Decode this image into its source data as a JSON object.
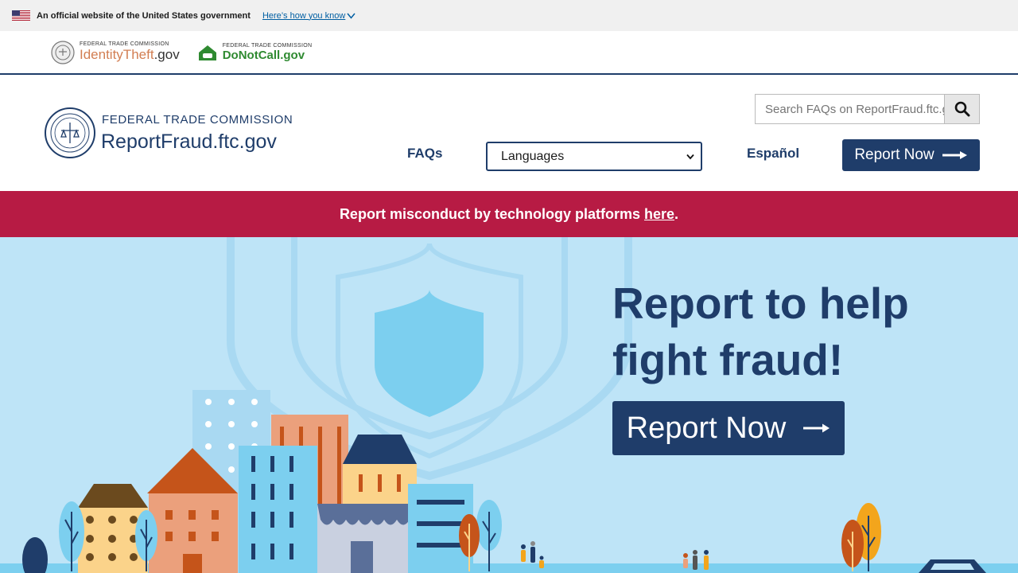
{
  "gov_banner": {
    "text": "An official website of the United States government",
    "link": "Here’s how you know"
  },
  "partners": {
    "identity_theft": {
      "small": "FEDERAL TRADE COMMISSION",
      "name_colored": "IdentityTheft",
      "name_suffix": ".gov"
    },
    "do_not_call": {
      "small": "FEDERAL TRADE COMMISSION",
      "name": "DoNotCall.gov"
    }
  },
  "header": {
    "agency": "FEDERAL TRADE COMMISSION",
    "site_name": "ReportFraud.ftc.gov",
    "search_placeholder": "Search FAQs on ReportFraud.ftc.gov",
    "nav_faqs": "FAQs",
    "languages_selected": "Languages",
    "nav_espanol": "Español",
    "report_now": "Report Now"
  },
  "alert": {
    "text": "Report misconduct by technology platforms ",
    "link": "here",
    "suffix": "."
  },
  "hero": {
    "title_line1": "Report to help",
    "title_line2": "fight fraud!",
    "button": "Report Now"
  },
  "colors": {
    "navy": "#1f3d6a",
    "alert_red": "#b71b44",
    "hero_bg": "#bee4f7"
  }
}
